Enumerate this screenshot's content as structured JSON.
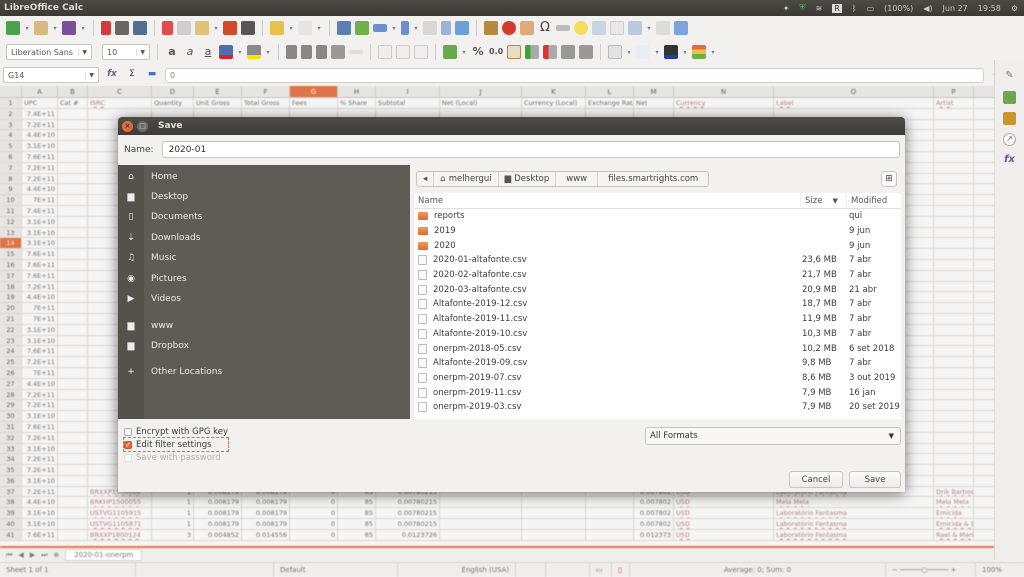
{
  "app": {
    "title": "LibreOffice Calc"
  },
  "system_tray": {
    "battery": "(100%)",
    "date": "Jun 27",
    "time": "19:58"
  },
  "toolbar": {
    "font_name": "Liberation Sans",
    "font_size": "10"
  },
  "formula_bar": {
    "name_box": "G14",
    "function_wizard_icon": "function-wizard-icon",
    "sum_icon": "sum-icon",
    "input_value": "0"
  },
  "spreadsheet": {
    "columns": [
      "A",
      "B",
      "C",
      "D",
      "E",
      "F",
      "G",
      "H",
      "I",
      "J",
      "K",
      "L",
      "M",
      "N",
      "O",
      "P"
    ],
    "selected_column": "G",
    "selected_row": "14",
    "header_row": [
      "UPC",
      "Cat #",
      "ISRC",
      "Quantity",
      "Unit Gross",
      "Total Gross",
      "Fees",
      "% Share",
      "Subtotal",
      "Net (Local)",
      "Currency (Local)",
      "Exchange Rate",
      "Net",
      "Currency",
      "Label",
      "Artist"
    ],
    "row_numbers": [
      "1",
      "2",
      "3",
      "4",
      "5",
      "6",
      "7",
      "8",
      "9",
      "10",
      "11",
      "12",
      "13",
      "14",
      "15",
      "16",
      "17",
      "18",
      "19",
      "20",
      "21",
      "22",
      "23",
      "24",
      "25",
      "26",
      "27",
      "28",
      "29",
      "30",
      "31",
      "32",
      "33",
      "34",
      "35",
      "36",
      "37",
      "38",
      "39",
      "40",
      "41"
    ],
    "upc_values": [
      "UPC",
      "7.4E+11",
      "7.2E+11",
      "4.4E+10",
      "3.1E+10",
      "7.6E+11",
      "7.2E+11",
      "7.2E+11",
      "4.4E+10",
      "7E+11",
      "7.4E+11",
      "3.1E+10",
      "3.1E+10",
      "3.1E+10",
      "7.6E+11",
      "7.6E+11",
      "7.6E+11",
      "7.2E+11",
      "4.4E+10",
      "7E+11",
      "7E+11",
      "3.1E+10",
      "3.1E+10",
      "7.6E+11",
      "7.2E+11",
      "7E+11",
      "4.4E+10",
      "7.2E+11",
      "7.2E+11",
      "3.1E+10",
      "7.6E+11",
      "7.2E+11",
      "3.1E+10",
      "7.2E+11",
      "7.2E+11",
      "3.1E+10",
      "7.2E+11",
      "4.4E+10",
      "3.1E+10",
      "3.1E+10",
      "7.6E+11"
    ],
    "bottom_rows": [
      {
        "isrc": "BRXXP1500000",
        "qty": "1",
        "unit": "0.008179",
        "total": "0.008179",
        "fees": "0",
        "share": "85",
        "subtotal": "0.00780215",
        "net": "0.007802",
        "cur": "USD",
        "label": "Laboratório Fantasma",
        "artist": "Drik Barbosa"
      },
      {
        "isrc": "BRKHP1500055",
        "qty": "1",
        "unit": "0.008179",
        "total": "0.008179",
        "fees": "0",
        "share": "85",
        "subtotal": "0.00780215",
        "net": "0.007802",
        "cur": "USD",
        "label": "Mela Mela",
        "artist": "Mela Mela"
      },
      {
        "isrc": "USTVG1105915",
        "qty": "1",
        "unit": "0.008179",
        "total": "0.008179",
        "fees": "0",
        "share": "85",
        "subtotal": "0.00780215",
        "net": "0.007802",
        "cur": "USD",
        "label": "Laboratório Fantasma",
        "artist": "Emicida"
      },
      {
        "isrc": "USTVG1105871",
        "qty": "1",
        "unit": "0.008179",
        "total": "0.008179",
        "fees": "0",
        "share": "85",
        "subtotal": "0.00780215",
        "net": "0.007802",
        "cur": "USD",
        "label": "Laboratório Fantasma",
        "artist": "Emicida & Beatnick & K-Salaa"
      },
      {
        "isrc": "BRXXP1800124",
        "qty": "3",
        "unit": "0.004852",
        "total": "0.014556",
        "fees": "0",
        "share": "85",
        "subtotal": "0.0123726",
        "net": "0.012373",
        "cur": "USD",
        "label": "Laboratório Fantasma",
        "artist": "Rael & Mariana Nolasco"
      }
    ]
  },
  "sheet_tabs": {
    "active": "2020-01-onerpm"
  },
  "status_bar": {
    "sheet": "Sheet 1 of 1",
    "style": "Default",
    "language": "English (USA)",
    "summary": "Average: 0; Sum: 0",
    "zoom": "100%"
  },
  "dialog": {
    "title": "Save",
    "name_label": "Name:",
    "name_value": "2020-01",
    "places": [
      {
        "label": "Home",
        "icon": "home-icon",
        "glyph": "⌂"
      },
      {
        "label": "Desktop",
        "icon": "folder-icon",
        "glyph": "▆"
      },
      {
        "label": "Documents",
        "icon": "document-icon",
        "glyph": "▯"
      },
      {
        "label": "Downloads",
        "icon": "download-icon",
        "glyph": "⇣"
      },
      {
        "label": "Music",
        "icon": "music-icon",
        "glyph": "♫"
      },
      {
        "label": "Pictures",
        "icon": "camera-icon",
        "glyph": "◉"
      },
      {
        "label": "Videos",
        "icon": "video-icon",
        "glyph": "▶"
      },
      {
        "label": "www",
        "icon": "folder-icon",
        "glyph": "▆"
      },
      {
        "label": "Dropbox",
        "icon": "folder-icon",
        "glyph": "▆"
      },
      {
        "label": "Other Locations",
        "icon": "plus-icon",
        "glyph": "+"
      }
    ],
    "path": [
      {
        "label": "melhergui",
        "icon": "home-icon"
      },
      {
        "label": "Desktop",
        "icon": "folder-icon"
      },
      {
        "label": "www",
        "icon": ""
      },
      {
        "label": "files.smartrights.com",
        "icon": ""
      }
    ],
    "columns": {
      "name": "Name",
      "size": "Size",
      "modified": "Modified"
    },
    "files": [
      {
        "name": "reports",
        "type": "folder",
        "size": "",
        "modified": "qui"
      },
      {
        "name": "2019",
        "type": "folder",
        "size": "",
        "modified": "9 jun"
      },
      {
        "name": "2020",
        "type": "folder",
        "size": "",
        "modified": "9 jun"
      },
      {
        "name": "2020-01-altafonte.csv",
        "type": "file",
        "size": "23,6 MB",
        "modified": "7 abr"
      },
      {
        "name": "2020-02-altafonte.csv",
        "type": "file",
        "size": "21,7 MB",
        "modified": "7 abr"
      },
      {
        "name": "2020-03-altafonte.csv",
        "type": "file",
        "size": "20,9 MB",
        "modified": "21 abr"
      },
      {
        "name": "Altafonte-2019-12.csv",
        "type": "file",
        "size": "18,7 MB",
        "modified": "7 abr"
      },
      {
        "name": "Altafonte-2019-11.csv",
        "type": "file",
        "size": "11,9 MB",
        "modified": "7 abr"
      },
      {
        "name": "Altafonte-2019-10.csv",
        "type": "file",
        "size": "10,3 MB",
        "modified": "7 abr"
      },
      {
        "name": "onerpm-2018-05.csv",
        "type": "file",
        "size": "10,2 MB",
        "modified": "6 set 2018"
      },
      {
        "name": "Altafonte-2019-09.csv",
        "type": "file",
        "size": "9,8 MB",
        "modified": "7 abr"
      },
      {
        "name": "onerpm-2019-07.csv",
        "type": "file",
        "size": "8,6 MB",
        "modified": "3 out 2019"
      },
      {
        "name": "onerpm-2019-11.csv",
        "type": "file",
        "size": "7,9 MB",
        "modified": "16 jan"
      },
      {
        "name": "onerpm-2019-03.csv",
        "type": "file",
        "size": "7,9 MB",
        "modified": "20 set 2019"
      }
    ],
    "options": {
      "encrypt": {
        "label": "Encrypt with GPG key",
        "checked": false
      },
      "edit_filter": {
        "label": "Edit filter settings",
        "checked": true
      },
      "password": {
        "label": "Save with password",
        "checked": false,
        "disabled": true
      }
    },
    "format": "All Formats",
    "cancel_label": "Cancel",
    "save_label": "Save"
  },
  "colors": {
    "accent": "#e9683a",
    "sidebar_bg": "#5f5c55",
    "titlebar_bg": "#3d3c38"
  }
}
